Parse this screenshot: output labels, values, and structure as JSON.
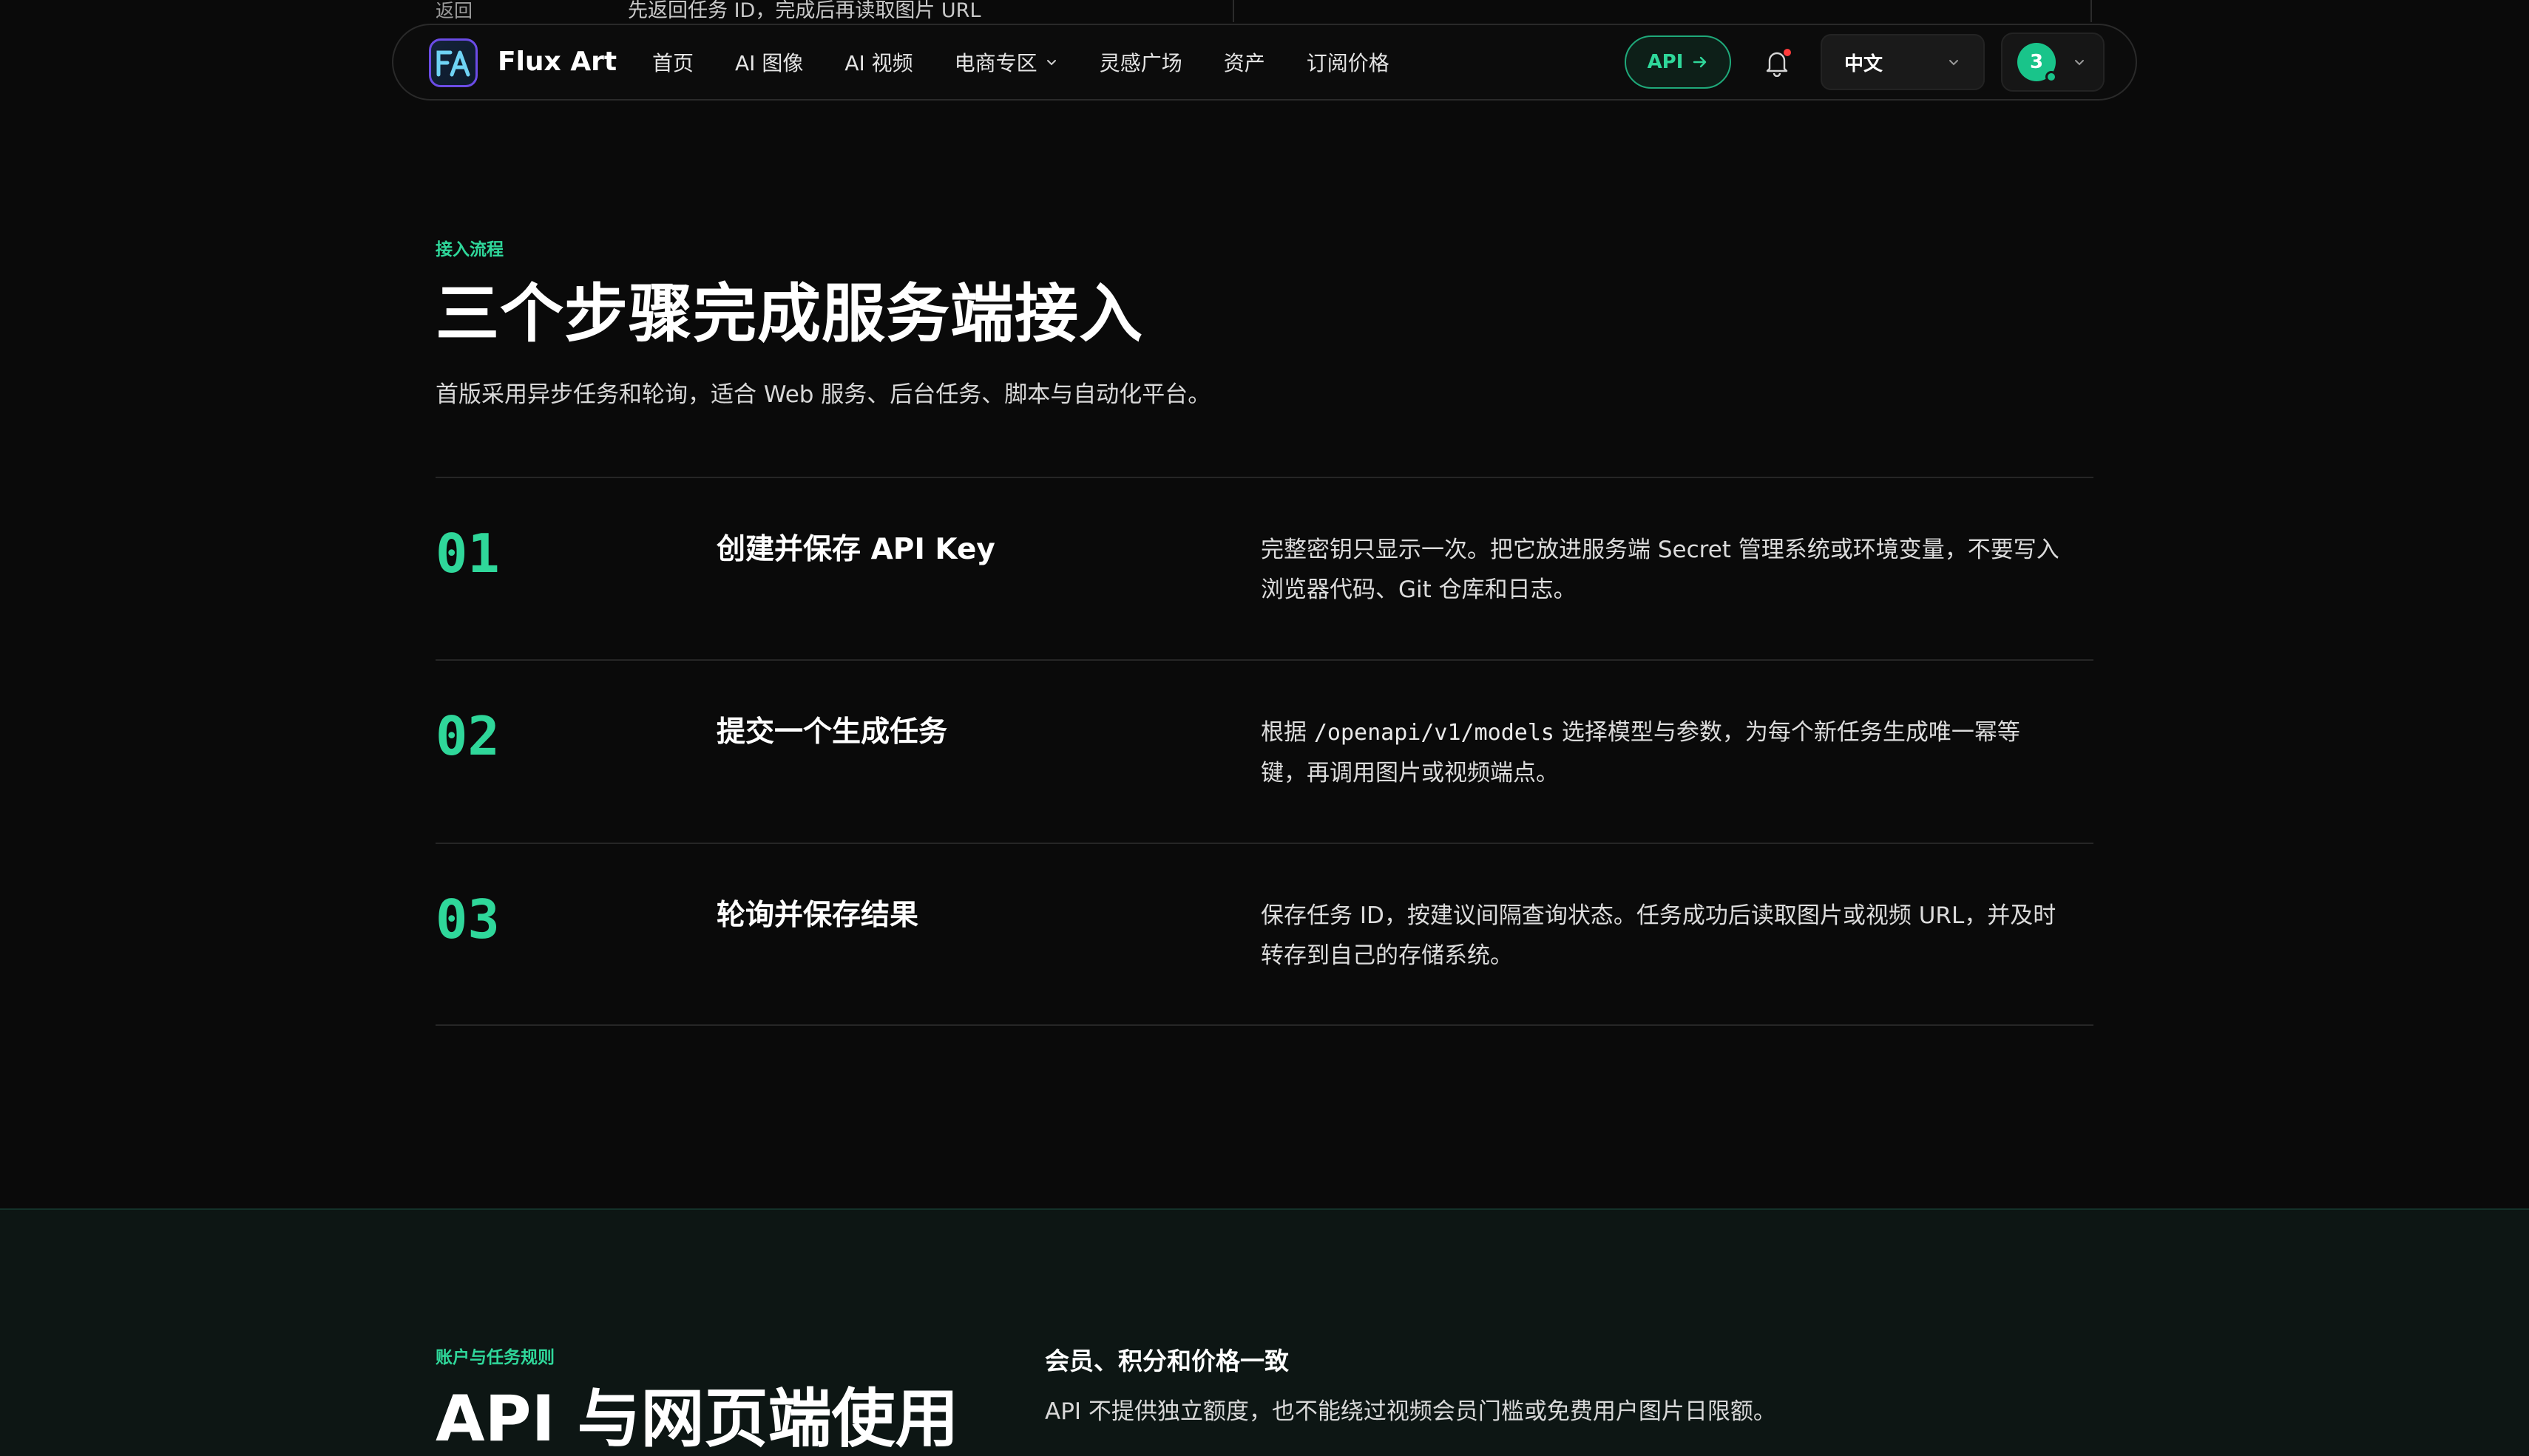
{
  "top_remnant": {
    "label": "返回",
    "text": "先返回任务 ID，完成后再读取图片 URL"
  },
  "nav": {
    "brand": "Flux Art",
    "menu": [
      {
        "label": "首页"
      },
      {
        "label": "AI 图像"
      },
      {
        "label": "AI 视频"
      },
      {
        "label": "电商专区",
        "has_dropdown": true
      },
      {
        "label": "灵感广场"
      },
      {
        "label": "资产"
      },
      {
        "label": "订阅价格"
      }
    ],
    "api_button": "API",
    "language": "中文",
    "avatar_count": "3"
  },
  "section_steps": {
    "eyebrow": "接入流程",
    "title": "三个步骤完成服务端接入",
    "lead": "首版采用异步任务和轮询，适合 Web 服务、后台任务、脚本与自动化平台。",
    "steps": [
      {
        "number": "01",
        "title": "创建并保存 API Key",
        "desc_line1": "完整密钥只显示一次。把它放进服务端 Secret 管理系统或环境变量，不要写入",
        "desc_line2": "浏览器代码、Git 仓库和日志。"
      },
      {
        "number": "02",
        "title": "提交一个生成任务",
        "desc_pre": "根据 ",
        "desc_code": "/openapi/v1/models",
        "desc_post": " 选择模型与参数，为每个新任务生成唯一幂等",
        "desc_line2": "键，再调用图片或视频端点。"
      },
      {
        "number": "03",
        "title": "轮询并保存结果",
        "desc_line1": "保存任务 ID，按建议间隔查询状态。任务成功后读取图片或视频 URL，并及时",
        "desc_line2": "转存到自己的存储系统。"
      }
    ]
  },
  "section_rules": {
    "eyebrow": "账户与任务规则",
    "title": "API 与网页端使用",
    "subtitle": "会员、积分和价格一致",
    "text": "API 不提供独立额度，也不能绕过视频会员门槛或免费用户图片日限额。"
  },
  "colors": {
    "accent": "#2fd79a",
    "background": "#0a0a0a",
    "section2_bg": "#0d1614",
    "notification_dot": "#ff3b3b"
  },
  "icons": {
    "logo": "flux-art-logo-icon",
    "arrow": "arrow-right-icon",
    "bell": "bell-icon",
    "chevron": "chevron-down-icon"
  }
}
